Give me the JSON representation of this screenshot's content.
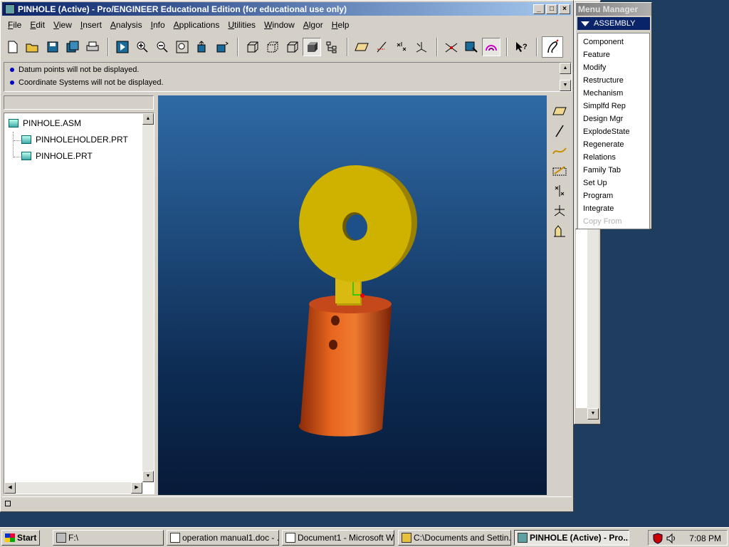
{
  "window": {
    "title": "PINHOLE (Active) - Pro/ENGINEER Educational Edition (for educational use only)",
    "buttons": [
      "_",
      "□",
      "×"
    ]
  },
  "menubar": [
    "File",
    "Edit",
    "View",
    "Insert",
    "Analysis",
    "Info",
    "Applications",
    "Utilities",
    "Window",
    "Algor",
    "Help"
  ],
  "messages": [
    "Datum points will not be displayed.",
    "Coordinate Systems will not be displayed."
  ],
  "model_tree": {
    "root": "PINHOLE.ASM",
    "children": [
      "PINHOLEHOLDER.PRT",
      "PINHOLE.PRT"
    ]
  },
  "colors": {
    "part_yellow": "#c9ad00",
    "part_orange": "#d6521a",
    "viewport_top": "#2f6aa6",
    "viewport_bottom": "#071a38"
  },
  "menu_manager": {
    "title": "Menu Manager",
    "header": "ASSEMBLY",
    "items": [
      "Component",
      "Feature",
      "Modify",
      "Restructure",
      "Mechanism",
      "Simplfd Rep",
      "Design Mgr",
      "ExplodeState",
      "Regenerate",
      "Relations",
      "Family Tab",
      "Set Up",
      "Program",
      "Integrate",
      "Copy From"
    ],
    "disabled": "Copy From"
  },
  "taskbar": {
    "start": "Start",
    "tasks": [
      "F:\\",
      "operation manual1.doc - ...",
      "Document1 - Microsoft W...",
      "C:\\Documents and Settin...",
      "PINHOLE (Active) - Pro..."
    ],
    "time": "7:08 PM"
  }
}
